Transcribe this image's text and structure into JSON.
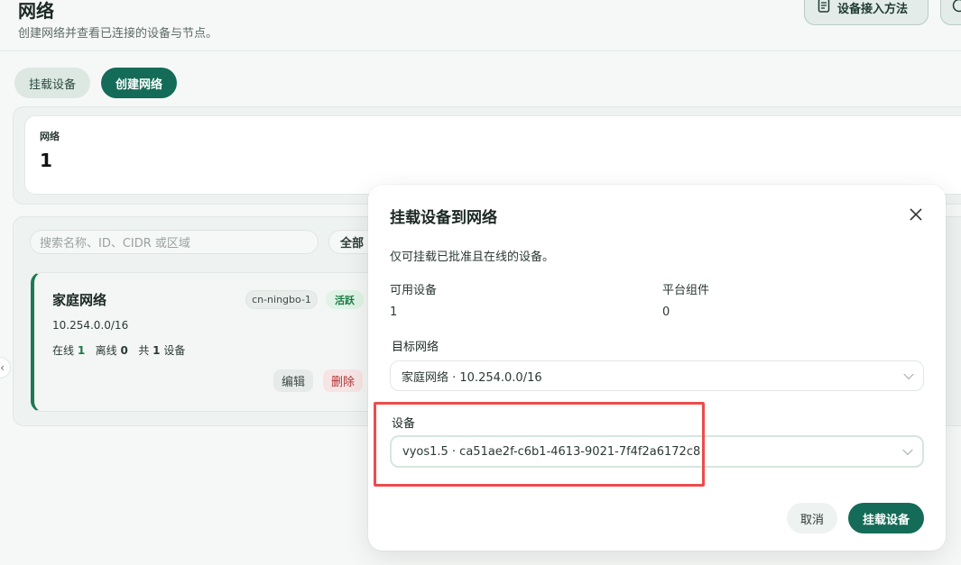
{
  "header": {
    "title": "网络",
    "subtitle": "创建网络并查看已连接的设备与节点。",
    "guide_button": "设备接入方法"
  },
  "toolbar": {
    "mount_label": "挂载设备",
    "create_label": "创建网络"
  },
  "stats": {
    "label": "网络",
    "value": "1"
  },
  "list": {
    "search_placeholder": "搜索名称、ID、CIDR 或区域",
    "filter_label": "全部"
  },
  "network_card": {
    "name": "家庭网络",
    "region": "cn-ningbo-1",
    "status": "活跃",
    "cidr": "10.254.0.0/16",
    "online_label": "在线",
    "online_count": "1",
    "offline_label": "离线",
    "offline_count": "0",
    "total_label": "共",
    "total_count": "1",
    "total_suffix": "设备",
    "edit_label": "编辑",
    "delete_label": "删除"
  },
  "modal": {
    "title": "挂载设备到网络",
    "description": "仅可挂载已批准且在线的设备。",
    "available_label": "可用设备",
    "available_value": "1",
    "platform_label": "平台组件",
    "platform_value": "0",
    "target_label": "目标网络",
    "target_value": "家庭网络 · 10.254.0.0/16",
    "device_label": "设备",
    "device_value": "vyos1.5 · ca51ae2f-c6b1-4613-9021-7f4f2a6172c8",
    "cancel_label": "取消",
    "confirm_label": "挂载设备"
  },
  "colors": {
    "accent": "#146b58",
    "active_green": "#1c7a45",
    "danger": "#b03434",
    "highlight": "#ee4b4b"
  }
}
